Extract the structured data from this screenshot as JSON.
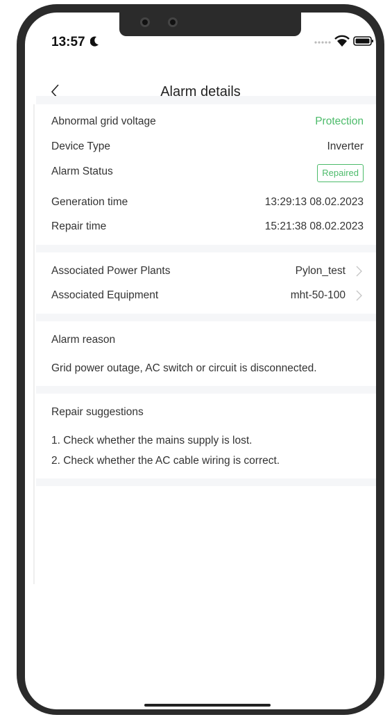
{
  "status_bar": {
    "time": "13:57"
  },
  "header": {
    "title": "Alarm details"
  },
  "alarm": {
    "name": "Abnormal grid voltage",
    "level": "Protection",
    "device_type_label": "Device Type",
    "device_type_value": "Inverter",
    "status_label": "Alarm Status",
    "status_value": "Repaired",
    "generation_label": "Generation time",
    "generation_value": "13:29:13 08.02.2023",
    "repair_label": "Repair time",
    "repair_value": "15:21:38 08.02.2023"
  },
  "association": {
    "plants_label": "Associated Power Plants",
    "plants_value": "Pylon_test",
    "equipment_label": "Associated Equipment",
    "equipment_value": "mht-50-100"
  },
  "reason": {
    "title": "Alarm reason",
    "text": "Grid power outage, AC switch or circuit is disconnected."
  },
  "suggestions": {
    "title": "Repair suggestions",
    "items": [
      "1. Check whether the mains supply is lost.",
      "2. Check whether the AC cable wiring is correct."
    ]
  },
  "colors": {
    "accent_green": "#4cbb6a",
    "divider": "#f5f6f8"
  }
}
